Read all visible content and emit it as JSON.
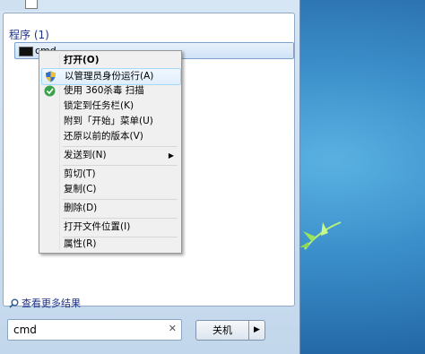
{
  "start_menu": {
    "section_header": "程序 (1)",
    "result_label": "cmd",
    "see_more": "查看更多结果",
    "search_value": "cmd",
    "clear_glyph": "✕",
    "shutdown_label": "关机",
    "shutdown_arrow": "▶"
  },
  "context_menu": {
    "items": [
      {
        "label": "打开(O)",
        "bold": true
      },
      {
        "label": "以管理员身份运行(A)",
        "icon": "shield-icon"
      },
      {
        "label": "使用 360杀毒 扫描",
        "icon": "antivirus-icon"
      },
      {
        "label": "锁定到任务栏(K)"
      },
      {
        "label": "附到「开始」菜单(U)"
      },
      {
        "label": "还原以前的版本(V)"
      },
      {
        "label": "发送到(N)",
        "submenu": true
      },
      {
        "label": "剪切(T)"
      },
      {
        "label": "复制(C)"
      },
      {
        "label": "删除(D)"
      },
      {
        "label": "打开文件位置(I)"
      },
      {
        "label": "属性(R)"
      }
    ],
    "submenu_arrow": "▶"
  },
  "colors": {
    "accent_header": "#1e3287",
    "desktop_blue": "#2b82c2",
    "hover_border": "#a8d8f8"
  }
}
